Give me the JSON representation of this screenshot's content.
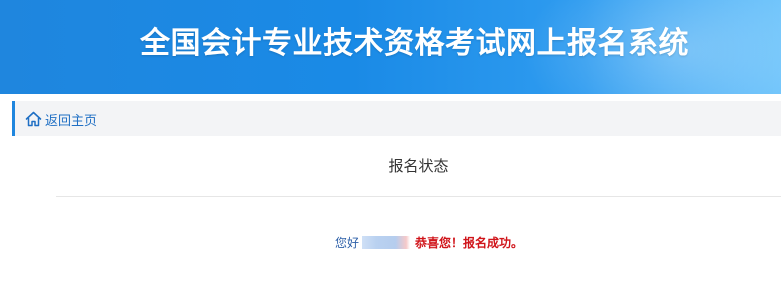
{
  "header": {
    "title": "全国会计专业技术资格考试网上报名系统"
  },
  "breadcrumb": {
    "home_label": "返回主页",
    "home_icon": "home-icon"
  },
  "panel": {
    "title": "报名状态"
  },
  "message": {
    "greeting": "您好",
    "success_text": "恭喜您！报名成功。"
  },
  "colors": {
    "header_blue": "#1f86de",
    "link_blue": "#1f6fc4",
    "success_red": "#d0141a"
  }
}
